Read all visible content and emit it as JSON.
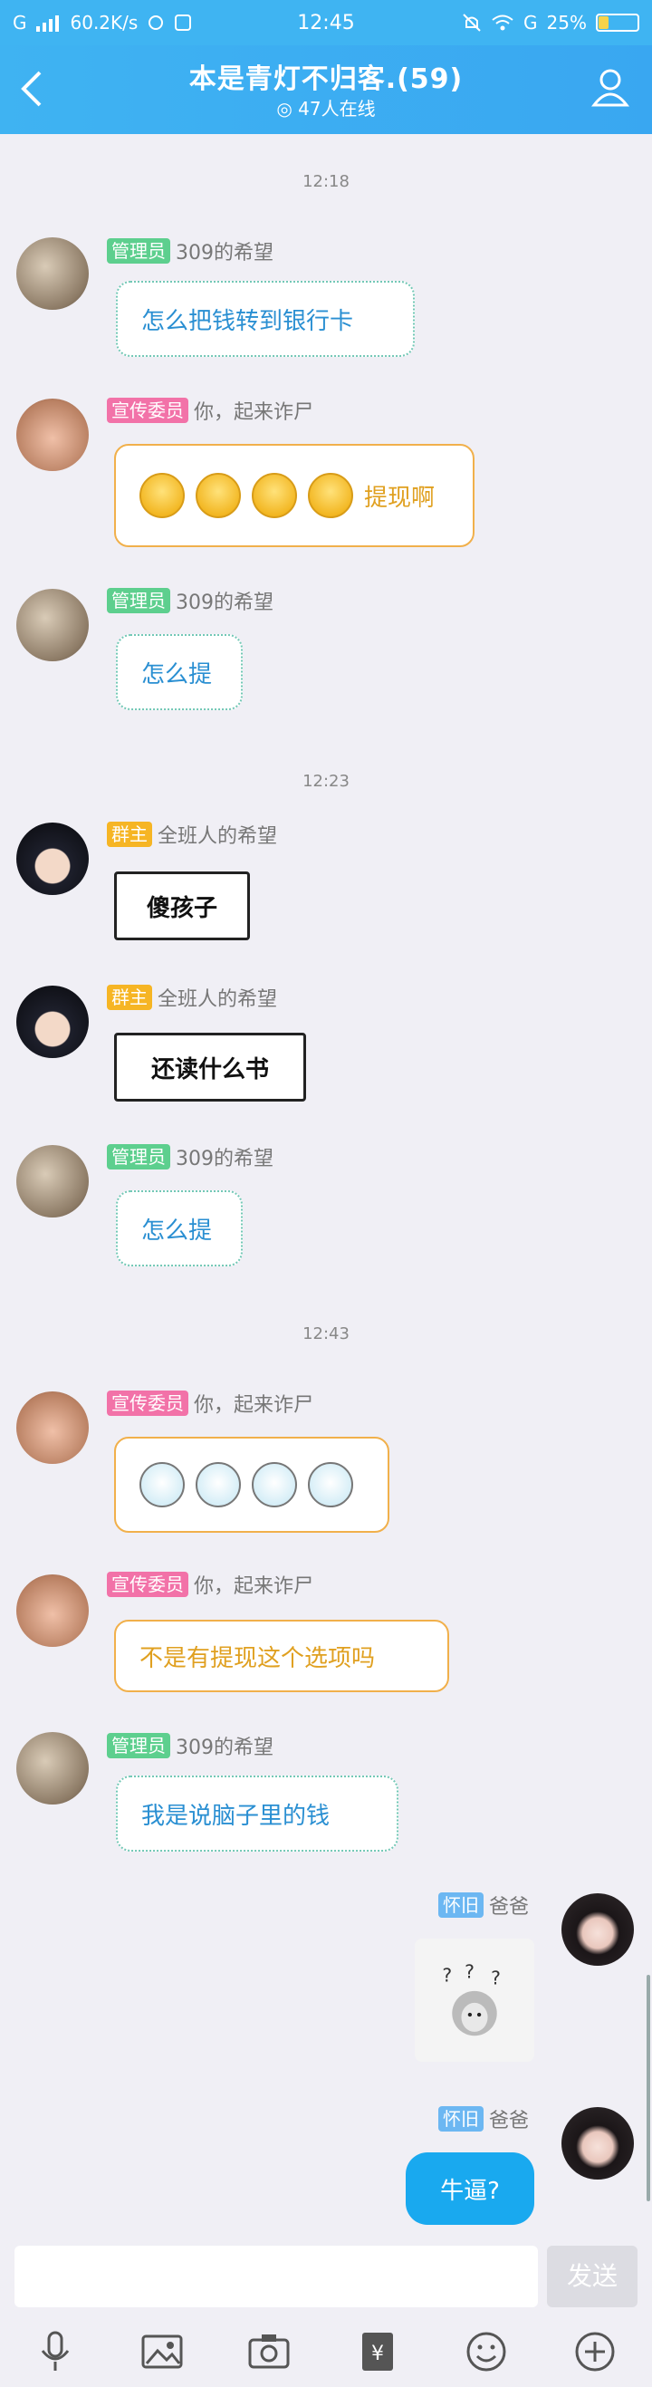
{
  "status_bar": {
    "signal": "G",
    "speed": "60.2K/s",
    "time": "12:45",
    "network": "G",
    "battery_text": "25%",
    "battery_level": 0.25
  },
  "header": {
    "back_label": "<",
    "title": "本是青灯不归客.(59)",
    "online": "47人在线"
  },
  "timestamps": [
    "12:18",
    "12:23",
    "12:43"
  ],
  "messages": [
    {
      "badge": "管理员",
      "name": "309的希望",
      "text": "怎么把钱转到银行卡"
    },
    {
      "badge": "宣传委员",
      "name": "你，起来诈尸",
      "text": "提现啊"
    },
    {
      "badge": "管理员",
      "name": "309的希望",
      "text": "怎么提"
    },
    {
      "badge": "群主",
      "name": "全班人的希望",
      "text": "傻孩子"
    },
    {
      "badge": "群主",
      "name": "全班人的希望",
      "text": "还读什么书"
    },
    {
      "badge": "管理员",
      "name": "309的希望",
      "text": "怎么提"
    },
    {
      "badge": "宣传委员",
      "name": "你，起来诈尸",
      "text": ""
    },
    {
      "badge": "宣传委员",
      "name": "你，起来诈尸",
      "text": "不是有提现这个选项吗"
    },
    {
      "badge": "管理员",
      "name": "309的希望",
      "text": "我是说脑子里的钱"
    },
    {
      "badge": "怀旧",
      "name": "爸爸",
      "text": ""
    },
    {
      "badge": "怀旧",
      "name": "爸爸",
      "text": "牛逼?"
    }
  ],
  "input": {
    "placeholder": "",
    "send_label": "发送"
  },
  "icons": [
    "mic-icon",
    "image-icon",
    "camera-icon",
    "red-packet-icon",
    "emoji-icon",
    "plus-icon"
  ],
  "colors": {
    "header": "#3fb4f2",
    "bubble_self": "#19a9ef",
    "admin_badge": "#5dcf8e",
    "publicity_badge": "#f272a8",
    "owner_badge": "#f6b524"
  }
}
